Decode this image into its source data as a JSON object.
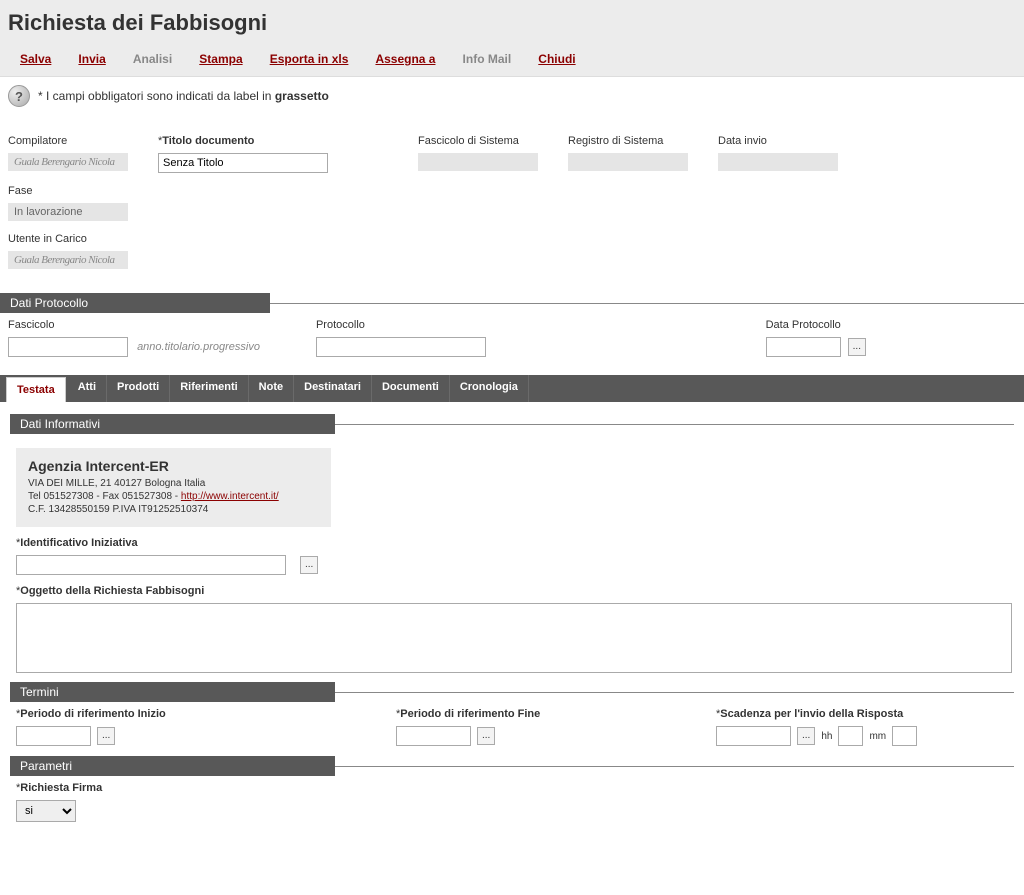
{
  "header": {
    "title": "Richiesta dei Fabbisogni"
  },
  "toolbar": {
    "salva": "Salva",
    "invia": "Invia",
    "analisi": "Analisi",
    "stampa": "Stampa",
    "esporta": "Esporta in xls",
    "assegna": "Assegna a",
    "infomail": "Info Mail",
    "chiudi": "Chiudi"
  },
  "infobar": {
    "prefix": "* I campi obbligatori sono indicati da label in ",
    "bold": "grassetto"
  },
  "fields": {
    "compilatore_label": "Compilatore",
    "compilatore_value": "Guala Berengario Nicola",
    "titolo_label": "Titolo documento",
    "titolo_value": "Senza Titolo",
    "fascicolo_sistema_label": "Fascicolo di Sistema",
    "fascicolo_sistema_value": "",
    "registro_label": "Registro di Sistema",
    "registro_value": "",
    "data_invio_label": "Data invio",
    "data_invio_value": "",
    "fase_label": "Fase",
    "fase_value": "In lavorazione",
    "utente_carico_label": "Utente in Carico",
    "utente_carico_value": "Guala Berengario Nicola"
  },
  "sections": {
    "dati_protocollo": "Dati Protocollo",
    "dati_informativi": "Dati Informativi",
    "termini": "Termini",
    "parametri": "Parametri"
  },
  "protocollo": {
    "fascicolo_label": "Fascicolo",
    "fascicolo_hint": "anno.titolario.progressivo",
    "protocollo_label": "Protocollo",
    "data_protocollo_label": "Data Protocollo"
  },
  "tabs": [
    "Testata",
    "Atti",
    "Prodotti",
    "Riferimenti",
    "Note",
    "Destinatari",
    "Documenti",
    "Cronologia"
  ],
  "info_box": {
    "title": "Agenzia Intercent-ER",
    "line1": "VIA DEI MILLE, 21 40127 Bologna Italia",
    "line2a": "Tel 051527308 - Fax 051527308 - ",
    "link": "http://www.intercent.it/",
    "line3": "C.F. 13428550159 P.IVA IT91252510374"
  },
  "testata": {
    "identificativo_label": "Identificativo Iniziativa",
    "oggetto_label": "Oggetto della Richiesta Fabbisogni"
  },
  "termini": {
    "inizio_label": "Periodo di riferimento Inizio",
    "fine_label": "Periodo di riferimento Fine",
    "scadenza_label": "Scadenza per l'invio della Risposta",
    "hh": "hh",
    "mm": "mm"
  },
  "parametri": {
    "richiesta_firma_label": "Richiesta Firma",
    "richiesta_firma_value": "si"
  },
  "glyphs": {
    "help": "?",
    "ellipsis": "..."
  }
}
